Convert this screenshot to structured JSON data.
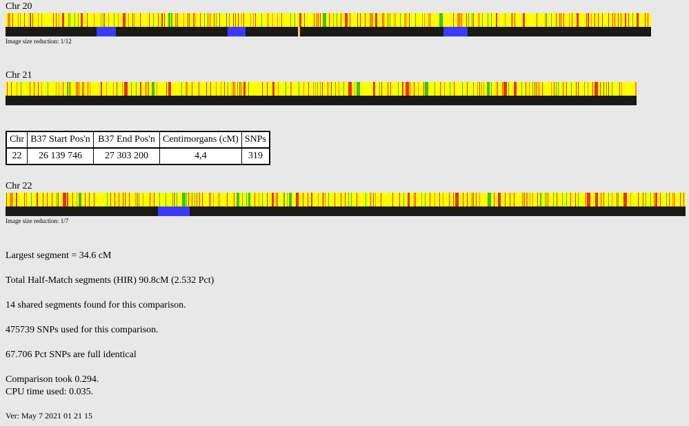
{
  "chromosomes": [
    {
      "label": "Chr 20",
      "reduction": "Image size reduction: 1/12",
      "match_segments": [
        [
          132,
          160
        ],
        [
          322,
          348
        ],
        [
          635,
          670
        ]
      ],
      "marker_lines": [
        [
          424,
          427
        ]
      ]
    },
    {
      "label": "Chr 21",
      "reduction": "",
      "match_segments": [],
      "marker_lines": []
    },
    {
      "label": "Chr 22",
      "reduction": "Image size reduction: 1/7",
      "match_segments": [
        [
          221,
          267
        ]
      ],
      "marker_lines": []
    }
  ],
  "segment_table": {
    "headers": [
      "Chr",
      "B37 Start Pos'n",
      "B37 End Pos'n",
      "Centimorgans (cM)",
      "SNPs"
    ],
    "rows": [
      [
        "22",
        "26 139 746",
        "27 303 200",
        "4,4",
        "319"
      ]
    ]
  },
  "stats": {
    "largest_segment": "Largest segment = 34.6 cM",
    "half_match": "Total Half-Match segments (HIR) 90.8cM (2.532 Pct)",
    "shared_segments": "14 shared segments found for this comparison.",
    "snps_used": "475739 SNPs used for this comparison.",
    "pct_identical": "67.706 Pct SNPs are full identical",
    "comparison_took": "Comparison took 0.294.",
    "cpu_time": "CPU time used: 0.035.",
    "version": "Ver: May 7 2021 01 21 15"
  },
  "colors": {
    "background": "#e8e8e8",
    "yellow": "#ffff00",
    "red": "#e8301c",
    "orange": "#f08a1c",
    "green": "#3fbf1f",
    "dark": "#1a1a1a",
    "blue": "#3a3aff",
    "marker": "#f5c37a"
  }
}
